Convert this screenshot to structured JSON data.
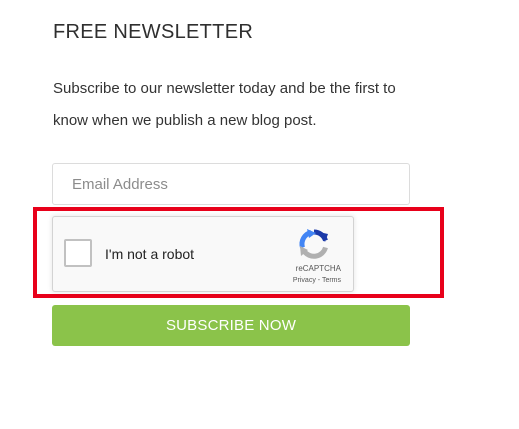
{
  "newsletter": {
    "title": "FREE NEWSLETTER",
    "description": "Subscribe to our newsletter today and be the first to know when we publish a new blog post.",
    "email_placeholder": "Email Address",
    "email_value": "",
    "subscribe_label": "SUBSCRIBE NOW"
  },
  "recaptcha": {
    "checkbox_label": "I'm not a robot",
    "checked": false,
    "brand": "reCAPTCHA",
    "privacy_label": "Privacy",
    "separator": " - ",
    "terms_label": "Terms",
    "logo_icon": "recaptcha-logo-icon"
  },
  "colors": {
    "button_green": "#8bc34a",
    "highlight_red": "#e8001a",
    "recaptcha_blue_dark": "#1c3aa9",
    "recaptcha_blue_light": "#4285f4",
    "recaptcha_gray": "#b0b0b0"
  }
}
